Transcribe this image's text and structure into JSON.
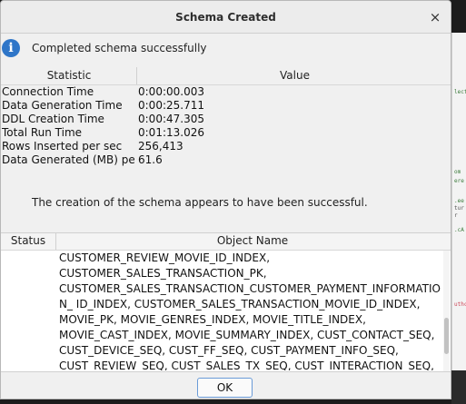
{
  "dialog": {
    "title": "Schema Created",
    "close_glyph": "×",
    "message": "Completed schema successfully",
    "info_icon": "i",
    "success_text": "The creation of the schema appears to have been successful."
  },
  "stats": {
    "headers": [
      "Statistic",
      "Value"
    ],
    "rows": [
      {
        "name": "Connection Time",
        "value": "0:00:00.003"
      },
      {
        "name": "Data Generation Time",
        "value": "0:00:25.711"
      },
      {
        "name": "DDL Creation Time",
        "value": "0:00:47.305"
      },
      {
        "name": "Total Run Time",
        "value": "0:01:13.026"
      },
      {
        "name": "Rows Inserted per sec",
        "value": "256,413"
      },
      {
        "name": "Data Generated (MB) per...",
        "value": "61.6"
      }
    ]
  },
  "objects": {
    "headers": [
      "Status",
      "Object Name"
    ],
    "text": "CUSTOMER_REVIEW_MOVIE_ID_INDEX, CUSTOMER_SALES_TRANSACTION_PK, CUSTOMER_SALES_TRANSACTION_CUSTOMER_PAYMENT_INFORMATION_ ID_INDEX, CUSTOMER_SALES_TRANSACTION_MOVIE_ID_INDEX, MOVIE_PK, MOVIE_GENRES_INDEX, MOVIE_TITLE_INDEX, MOVIE_CAST_INDEX, MOVIE_SUMMARY_INDEX, CUST_CONTACT_SEQ, CUST_DEVICE_SEQ, CUST_FF_SEQ, CUST_PAYMENT_INFO_SEQ, CUST_REVIEW_SEQ, CUST_SALES_TX_SEQ, CUST_INTERACTION_SEQ,"
  },
  "buttons": {
    "ok": "OK"
  },
  "colors": {
    "accent": "#2f76c8",
    "button_border": "#6a9bd8"
  },
  "icons": {
    "info": "info-icon",
    "close": "close-icon"
  }
}
